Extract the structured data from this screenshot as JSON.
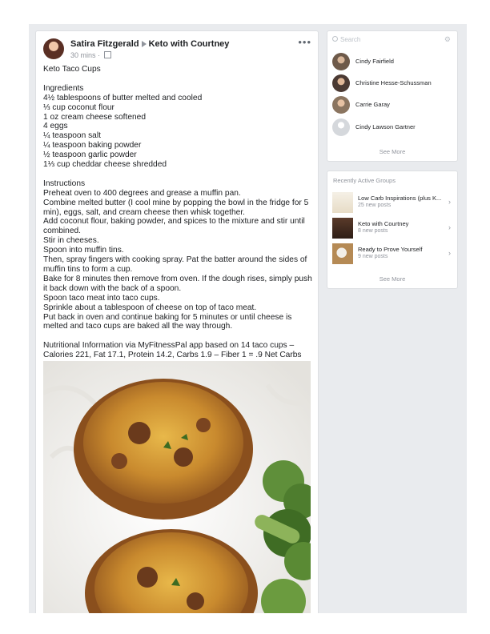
{
  "post": {
    "author": "Satira Fitzgerald",
    "group": "Keto with Courtney",
    "time": "30 mins",
    "separator": "·",
    "more": "•••",
    "title": "Keto Taco Cups",
    "ingredients_heading": "Ingredients",
    "ingredients": [
      "4½ tablespoons of butter melted and cooled",
      "⅓ cup coconut flour",
      "1 oz cream cheese softened",
      "4 eggs",
      "¼ teaspoon salt",
      "¼ teaspoon baking powder",
      "½ teaspoon garlic powder",
      "1⅓ cup cheddar cheese shredded"
    ],
    "instructions_heading": "Instructions",
    "instructions": [
      "Preheat oven to 400 degrees and grease a muffin pan.",
      "Combine melted butter (I cool mine by popping the bowl in the fridge for 5 min), eggs, salt, and cream cheese then whisk together.",
      "Add coconut flour, baking powder, and spices to the mixture and stir until combined.",
      "Stir in cheeses.",
      "Spoon into muffin tins.",
      "Then, spray fingers with cooking spray. Pat the batter around the sides of muffin tins to form a cup.",
      "Bake for 8 minutes then remove from oven. If the dough rises, simply push it back down with the back of a spoon.",
      "Spoon taco meat into taco cups.",
      "Sprinkle about a tablespoon of cheese on top of taco meat.",
      "Put back in oven and continue baking for 5 minutes or until cheese is melted and taco cups are baked all the way through."
    ],
    "nutrition": "Nutritional Information via MyFitnessPal app based on 14 taco cups – Calories 221, Fat 17.1, Protein 14.2, Carbs 1.9 – Fiber 1 = .9 Net Carbs"
  },
  "sidebar": {
    "search_placeholder": "Search",
    "contacts": [
      {
        "name": "Cindy Fairfield"
      },
      {
        "name": "Christine Hesse-Schussman"
      },
      {
        "name": "Carrie Garay"
      },
      {
        "name": "Cindy Lawson Gartner"
      }
    ],
    "see_more": "See More",
    "groups_title": "Recently Active Groups",
    "groups": [
      {
        "name": "Low Carb Inspirations (plus K...",
        "sub": "25 new posts"
      },
      {
        "name": "Keto with Courtney",
        "sub": "8 new posts"
      },
      {
        "name": "Ready to Prove Yourself",
        "sub": "9 new posts"
      }
    ],
    "groups_see_more": "See More"
  },
  "colors": {
    "background": "#e9ebee",
    "card": "#ffffff",
    "muted_text": "#90949c",
    "text": "#1c1e21"
  },
  "icons": [
    "ellipsis-icon",
    "globe-icon",
    "search-icon",
    "gear-icon",
    "chevron-right-icon"
  ]
}
